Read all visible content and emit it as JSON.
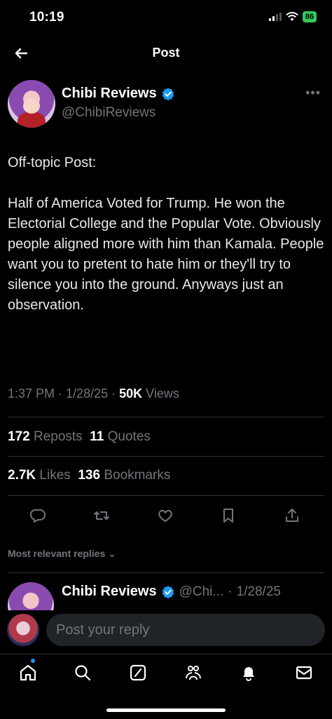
{
  "status_bar": {
    "time": "10:19",
    "battery": "86"
  },
  "nav": {
    "title": "Post"
  },
  "post": {
    "display_name": "Chibi Reviews",
    "handle": "@ChibiReviews",
    "paragraphs": [
      "Off-topic Post:",
      "Half of America Voted for Trump. He won the Electorial College and the Popular Vote. Obviously people aligned more with him than Kamala. People want you to pretent to hate him or they'll try to silence you into the ground. Anyways just an observation."
    ],
    "time": "1:37 PM",
    "date": "1/28/25",
    "views_count": "50K",
    "views_label": "Views",
    "reposts_count": "172",
    "reposts_label": "Reposts",
    "quotes_count": "11",
    "quotes_label": "Quotes",
    "likes_count": "2.7K",
    "likes_label": "Likes",
    "bookmarks_count": "136",
    "bookmarks_label": "Bookmarks"
  },
  "replies": {
    "sort_label": "Most relevant replies",
    "preview": {
      "display_name": "Chibi Reviews",
      "handle": "@Chi...",
      "date": "1/28/25"
    }
  },
  "composer": {
    "placeholder": "Post your reply"
  },
  "colors": {
    "accent": "#1d9bf0",
    "background": "#000000",
    "secondary_text": "#71767b",
    "battery": "#34c759"
  },
  "icons": [
    "back-arrow-icon",
    "verified-icon",
    "more-icon",
    "reply-icon",
    "repost-icon",
    "like-icon",
    "bookmark-icon",
    "share-icon",
    "home-icon",
    "search-icon",
    "grok-icon",
    "communities-icon",
    "notifications-icon",
    "messages-icon"
  ]
}
